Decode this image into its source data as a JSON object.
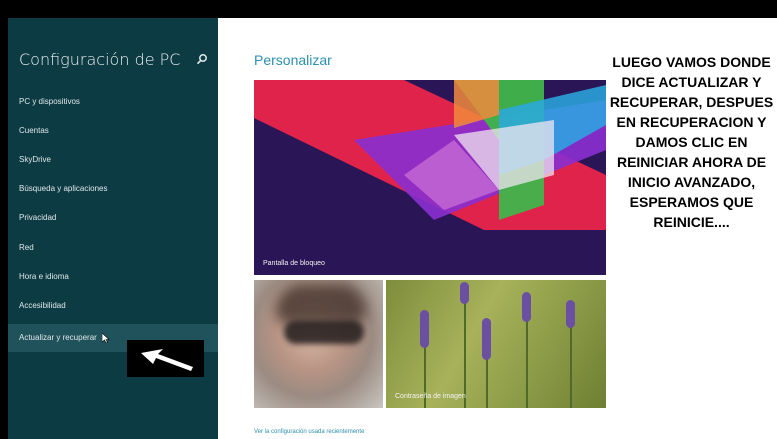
{
  "sidebar": {
    "title": "Configuración de PC",
    "items": [
      {
        "label": "PC y dispositivos"
      },
      {
        "label": "Cuentas"
      },
      {
        "label": "SkyDrive"
      },
      {
        "label": "Búsqueda y aplicaciones"
      },
      {
        "label": "Privacidad"
      },
      {
        "label": "Red"
      },
      {
        "label": "Hora e idioma"
      },
      {
        "label": "Accesibilidad"
      },
      {
        "label": "Actualizar y recuperar"
      }
    ],
    "active_index": 8
  },
  "main": {
    "title": "Personalizar",
    "lock_screen_label": "Pantalla de bloqueo",
    "picture_password_label": "Contraseña de imagen",
    "recent_settings_link": "Ver la configuración usada recientemente"
  },
  "overlay": {
    "text": "LUEGO VAMOS DONDE DICE ACTUALIZAR Y RECUPERAR, DESPUES EN RECUPERACION Y DAMOS CLIC EN REINICIAR AHORA DE INICIO AVANZADO, ESPERAMOS QUE REINICIE...."
  },
  "colors": {
    "sidebar_bg": "#0d3b44",
    "sidebar_active": "#1f525a",
    "accent": "#2b8fb0",
    "lock_bg": "#2a1556"
  },
  "icons": {
    "search": "search-icon",
    "arrow": "arrow-pointer-icon",
    "cursor": "mouse-cursor-icon"
  }
}
